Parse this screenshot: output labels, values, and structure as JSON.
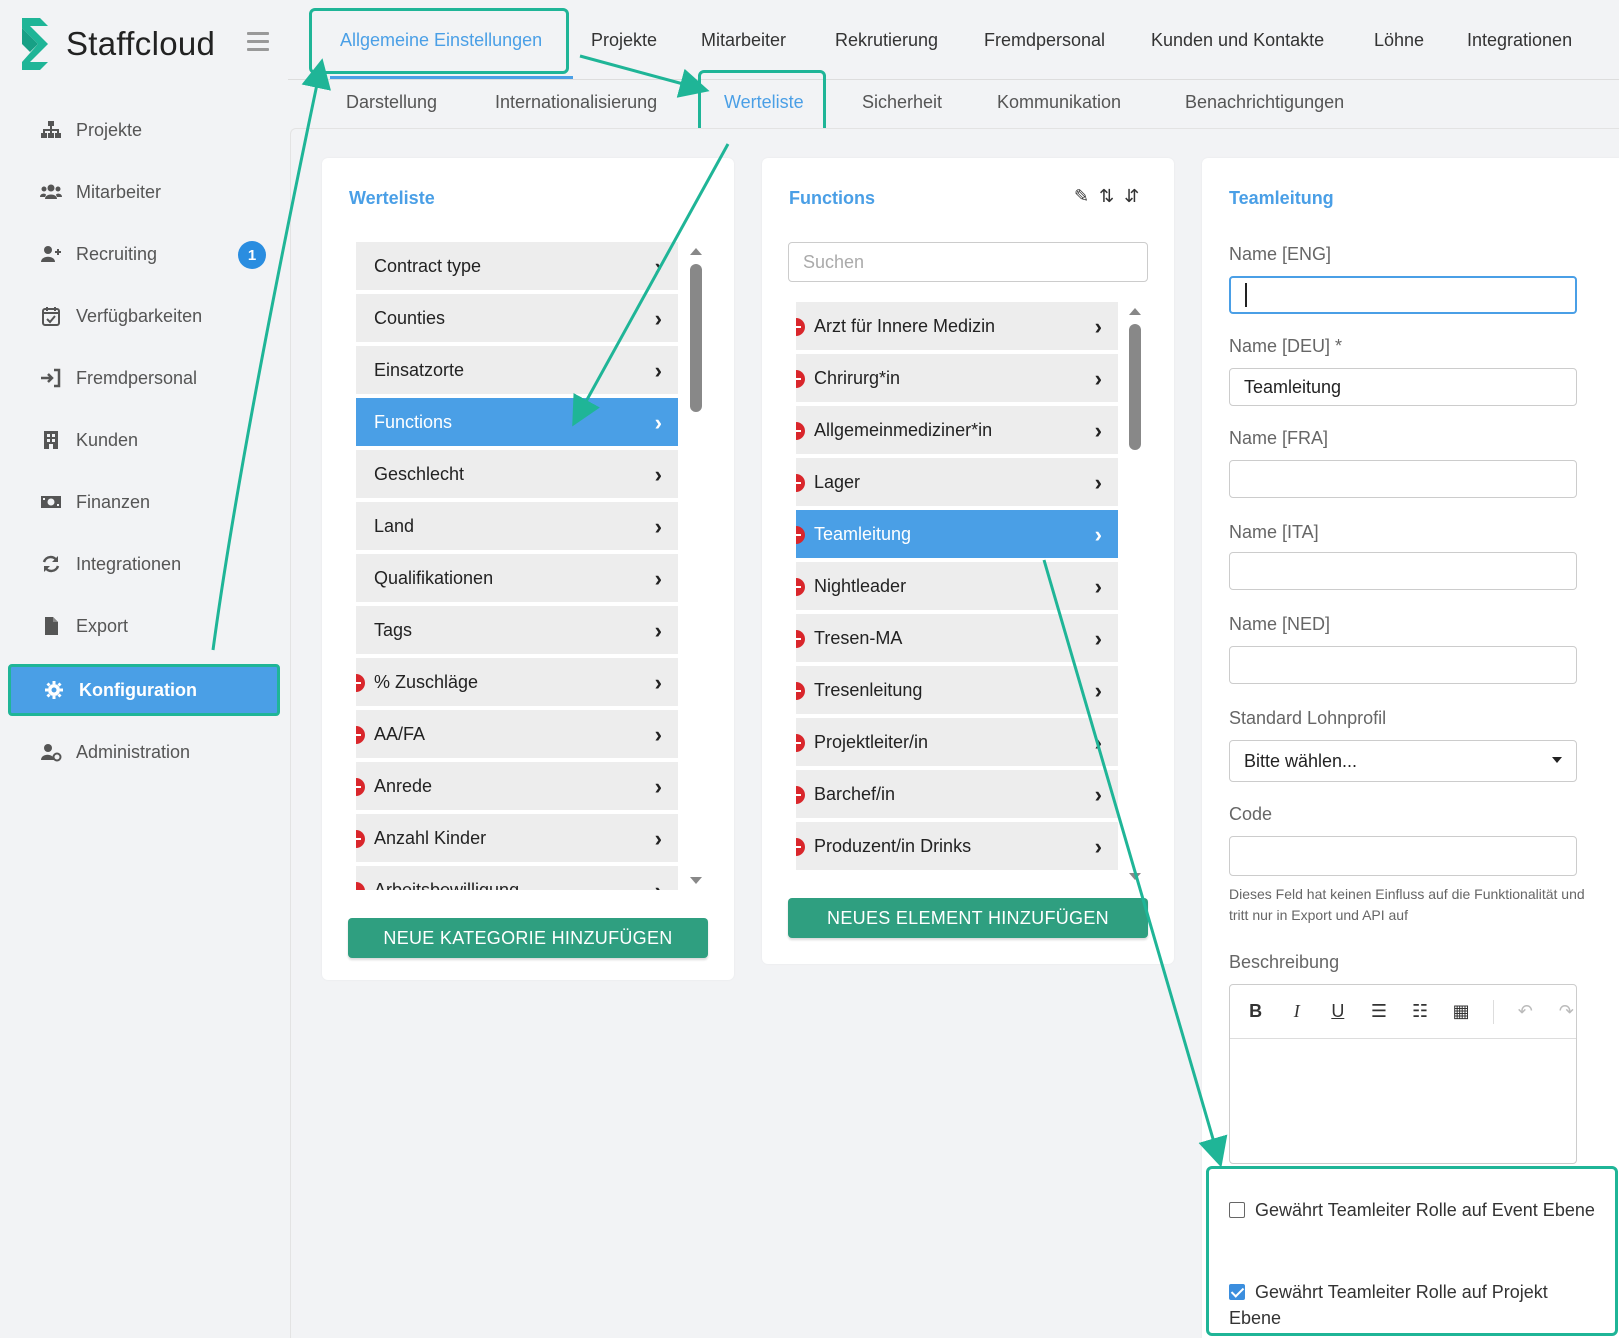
{
  "app": {
    "name": "Staffcloud"
  },
  "sidebar": {
    "items": [
      {
        "label": "Projekte",
        "icon": "sitemap-icon"
      },
      {
        "label": "Mitarbeiter",
        "icon": "users-icon"
      },
      {
        "label": "Recruiting",
        "icon": "user-plus-icon",
        "badge": "1"
      },
      {
        "label": "Verfügbarkeiten",
        "icon": "calendar-check-icon"
      },
      {
        "label": "Fremdpersonal",
        "icon": "sign-in-icon"
      },
      {
        "label": "Kunden",
        "icon": "building-icon"
      },
      {
        "label": "Finanzen",
        "icon": "money-icon"
      },
      {
        "label": "Integrationen",
        "icon": "refresh-icon"
      },
      {
        "label": "Export",
        "icon": "file-icon"
      },
      {
        "label": "Konfiguration",
        "icon": "gear-icon",
        "active": true
      },
      {
        "label": "Administration",
        "icon": "user-gear-icon"
      }
    ]
  },
  "topnav": {
    "tabs": [
      "Allgemeine Einstellungen",
      "Projekte",
      "Mitarbeiter",
      "Rekrutierung",
      "Fremdpersonal",
      "Kunden und Kontakte",
      "Löhne",
      "Integrationen"
    ],
    "active": "Allgemeine Einstellungen"
  },
  "subnav": {
    "tabs": [
      "Darstellung",
      "Internationalisierung",
      "Werteliste",
      "Sicherheit",
      "Kommunikation",
      "Benachrichtigungen"
    ],
    "active": "Werteliste"
  },
  "werteliste": {
    "title": "Werteliste",
    "items": [
      {
        "label": "Contract type",
        "removable": false
      },
      {
        "label": "Counties",
        "removable": false
      },
      {
        "label": "Einsatzorte",
        "removable": false
      },
      {
        "label": "Functions",
        "removable": false,
        "active": true
      },
      {
        "label": "Geschlecht",
        "removable": false
      },
      {
        "label": "Land",
        "removable": false
      },
      {
        "label": "Qualifikationen",
        "removable": false
      },
      {
        "label": "Tags",
        "removable": false
      },
      {
        "label": "% Zuschläge",
        "removable": true
      },
      {
        "label": "AA/FA",
        "removable": true
      },
      {
        "label": "Anrede",
        "removable": true
      },
      {
        "label": "Anzahl Kinder",
        "removable": true
      },
      {
        "label": "Arbeitsbewilligung",
        "removable": true
      }
    ],
    "add_button": "NEUE KATEGORIE HINZUFÜGEN"
  },
  "functions": {
    "title": "Functions",
    "search_placeholder": "Suchen",
    "items": [
      {
        "label": "Arzt für Innere Medizin"
      },
      {
        "label": "Chrirurg*in"
      },
      {
        "label": "Allgemeinmediziner*in"
      },
      {
        "label": "Lager"
      },
      {
        "label": "Teamleitung",
        "active": true
      },
      {
        "label": "Nightleader"
      },
      {
        "label": "Tresen-MA"
      },
      {
        "label": "Tresenleitung"
      },
      {
        "label": "Projektleiter/in"
      },
      {
        "label": "Barchef/in"
      },
      {
        "label": "Produzent/in Drinks"
      }
    ],
    "add_button": "NEUES ELEMENT HINZUFÜGEN"
  },
  "detail": {
    "title": "Teamleitung",
    "fields": {
      "name_eng": {
        "label": "Name [ENG]",
        "value": ""
      },
      "name_deu": {
        "label": "Name [DEU] *",
        "value": "Teamleitung"
      },
      "name_fra": {
        "label": "Name [FRA]",
        "value": ""
      },
      "name_ita": {
        "label": "Name [ITA]",
        "value": ""
      },
      "name_ned": {
        "label": "Name [NED]",
        "value": ""
      },
      "lohnprofil": {
        "label": "Standard Lohnprofil",
        "value": "Bitte wählen..."
      },
      "code": {
        "label": "Code",
        "value": "",
        "help": "Dieses Feld hat keinen Einfluss auf die Funktionalität und tritt nur in Export und API auf"
      },
      "beschreibung": {
        "label": "Beschreibung"
      }
    },
    "checkboxes": [
      {
        "label": "Gewährt Teamleiter Rolle auf Event Ebene",
        "checked": false
      },
      {
        "label": "Gewährt Teamleiter Rolle auf Projekt Ebene",
        "checked": true
      }
    ]
  },
  "colors": {
    "accent": "#4a9fe6",
    "highlight": "#1fb597",
    "button": "#2f9f80",
    "remove": "#d9262b"
  }
}
